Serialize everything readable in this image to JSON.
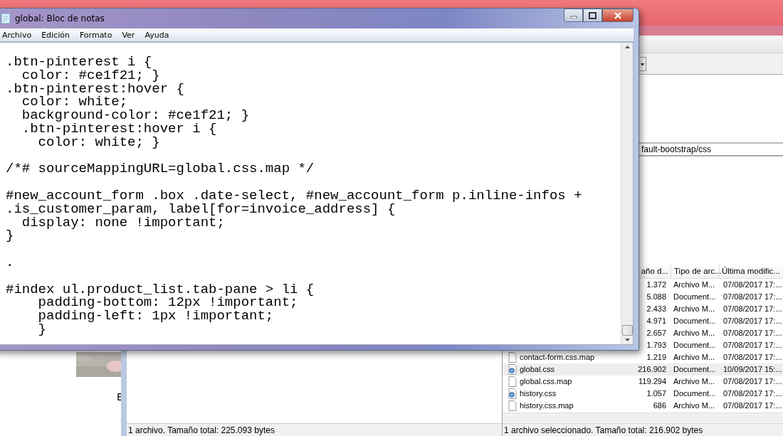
{
  "notepad": {
    "title": "global: Bloc de notas",
    "menu": [
      "Archivo",
      "Edición",
      "Formato",
      "Ver",
      "Ayuda"
    ],
    "text": ".btn-pinterest i {\n  color: #ce1f21; }\n.btn-pinterest:hover {\n  color: white;\n  background-color: #ce1f21; }\n  .btn-pinterest:hover i {\n    color: white; }\n\n/*# sourceMappingURL=global.css.map */\n\n#new_account_form .box .date-select, #new_account_form p.inline-infos +\n.is_customer_param, label[for=invoice_address] {\n  display: none !important;\n}\n\n.\n\n#index ul.product_list.tab-pane > li {\n    padding-bottom: 12px !important;\n    padding-left: 1px !important;\n    }"
  },
  "ftp": {
    "remote_path": "fault-bootstrap/css",
    "columns": [
      "año d...",
      "Tipo de arc...",
      "Última modific..."
    ],
    "rows": [
      {
        "size": "1.372",
        "type": "Archivo M...",
        "modified": "07/08/2017 17:...",
        "selected": false
      },
      {
        "size": "5.088",
        "type": "Document...",
        "modified": "07/08/2017 17:...",
        "selected": false
      },
      {
        "size": "2.433",
        "type": "Archivo M...",
        "modified": "07/08/2017 17:...",
        "selected": false
      },
      {
        "size": "4.971",
        "type": "Document...",
        "modified": "07/08/2017 17:...",
        "selected": false
      },
      {
        "size": "2.657",
        "type": "Archivo M...",
        "modified": "07/08/2017 17:...",
        "selected": false
      },
      {
        "size": "1.793",
        "type": "Document...",
        "modified": "07/08/2017 17:...",
        "selected": false
      },
      {
        "name": "contact-form.css.map",
        "kind": "file",
        "size": "1.219",
        "type": "Archivo M...",
        "modified": "07/08/2017 17:...",
        "selected": false
      },
      {
        "name": "global.css",
        "kind": "css",
        "size": "216.902",
        "type": "Document...",
        "modified": "10/09/2017 15:...",
        "selected": true
      },
      {
        "name": "global.css.map",
        "kind": "file",
        "size": "119.294",
        "type": "Archivo M...",
        "modified": "07/08/2017 17:...",
        "selected": false
      },
      {
        "name": "history.css",
        "kind": "css",
        "size": "1.057",
        "type": "Document...",
        "modified": "07/08/2017 17:...",
        "selected": false
      },
      {
        "name": "history.css.map",
        "kind": "file",
        "size": "686",
        "type": "Archivo M...",
        "modified": "07/08/2017 17:...",
        "selected": false
      }
    ],
    "local_status": "1 archivo. Tamaño total: 225.093 bytes",
    "remote_status": "1 archivo seleccionado. Tamaño total: 216.902 bytes",
    "side_letter": "E"
  }
}
